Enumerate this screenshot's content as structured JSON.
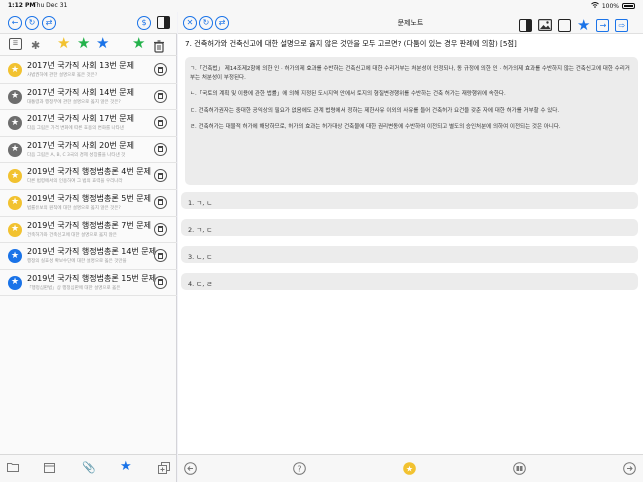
{
  "status": {
    "time": "1:12 PM",
    "date": "Thu Dec 31",
    "battery": "100%"
  },
  "colors": {
    "accent": "#1a73e8",
    "gold": "#f2c230",
    "green": "#23b24b",
    "gray": "#6e6e6e",
    "blue": "#1a73e8"
  },
  "sidebar": {
    "items": [
      {
        "title": "2017년 국가직 사회 13번 문제",
        "sub": "사법권하에 관한 설명으로 옳은 것은?",
        "star": "gold"
      },
      {
        "title": "2017년 국가직 사회 14번 문제",
        "sub": "대통령과 행정부에 관한 설명으로 옳지 않은 것은?",
        "star": "gray"
      },
      {
        "title": "2017년 국가직 사회 17번 문제",
        "sub": "다음 그림은 가격 변화에 따른 효용의 변화를 나타낸",
        "star": "gray"
      },
      {
        "title": "2017년 국가직 사회 20번 문제",
        "sub": "다음 그림은 A, B, C 3국의 경제 성장률을 나타낸 것",
        "star": "gray"
      },
      {
        "title": "2019년 국가직 행정법총론 4번 문제",
        "sub": "다른 법령에서의 인용하여 그 법의 효력을 우리나라",
        "star": "gold"
      },
      {
        "title": "2019년 국가직 행정법총론 5번 문제",
        "sub": "법률유보의 원칙에 대한 설명으로 옳지 않은 것은?",
        "star": "gold"
      },
      {
        "title": "2019년 국가직 행정법총론 7번 문제",
        "sub": "건축허가와 건축신고에 대한 설명으로 옳지 않은",
        "star": "gold"
      },
      {
        "title": "2019년 국가직 행정법총론 14번 문제",
        "sub": "행정의 실효성 확보수단에 대한 설명으로 옳은 것만을",
        "star": "blue"
      },
      {
        "title": "2019년 국가직 행정법총론 15번 문제",
        "sub": "「행정심판법」상 행정심판에 대한 설명으로 옳은",
        "star": "blue"
      }
    ]
  },
  "main": {
    "heading": "문제노트",
    "question": "7. 건축허가와 건축신고에 대한 설명으로 옳지 않은 것만을 모두 고르면? (다툼이 있는 경우 판례에 의함) [5점]",
    "statements": [
      "ㄱ.「건축법」 제14조제2항에 의한 인 · 허가의제 효과를 수반하는 건축신고에 대한 수리거부는 처분성이 인정되나, 동 규정에 의한 인 · 허가의제 효과를 수반하지 않는 건축신고에 대한 수리거부는 처분성이 부정된다.",
      "ㄴ.「국토의 계획 및 이용에 관한 법률」에 의해 지정된 도시지역 안에서 토지의 형질변경행위를 수반하는 건축 허가는 재량행위에 속한다.",
      "ㄷ. 건축허가권자는 중대한 공익상의 필요가 없음에도 관계 법령에서 정하는 제한사유 이외의 사유를 들어 건축허가 요건을 갖춘 자에 대한 허가를 거부할 수 있다.",
      "ㄹ. 건축허가는 대물적 허가에 해당하므로, 허가의 효과는 허가대상 건축물에 대한 권리변동에 수반하여 이전되고 별도의 승인처분에 의하여 이전되는 것은 아니다."
    ],
    "options": [
      "1. ㄱ, ㄴ",
      "2. ㄱ, ㄷ",
      "3. ㄴ, ㄷ",
      "4. ㄷ, ㄹ"
    ]
  }
}
